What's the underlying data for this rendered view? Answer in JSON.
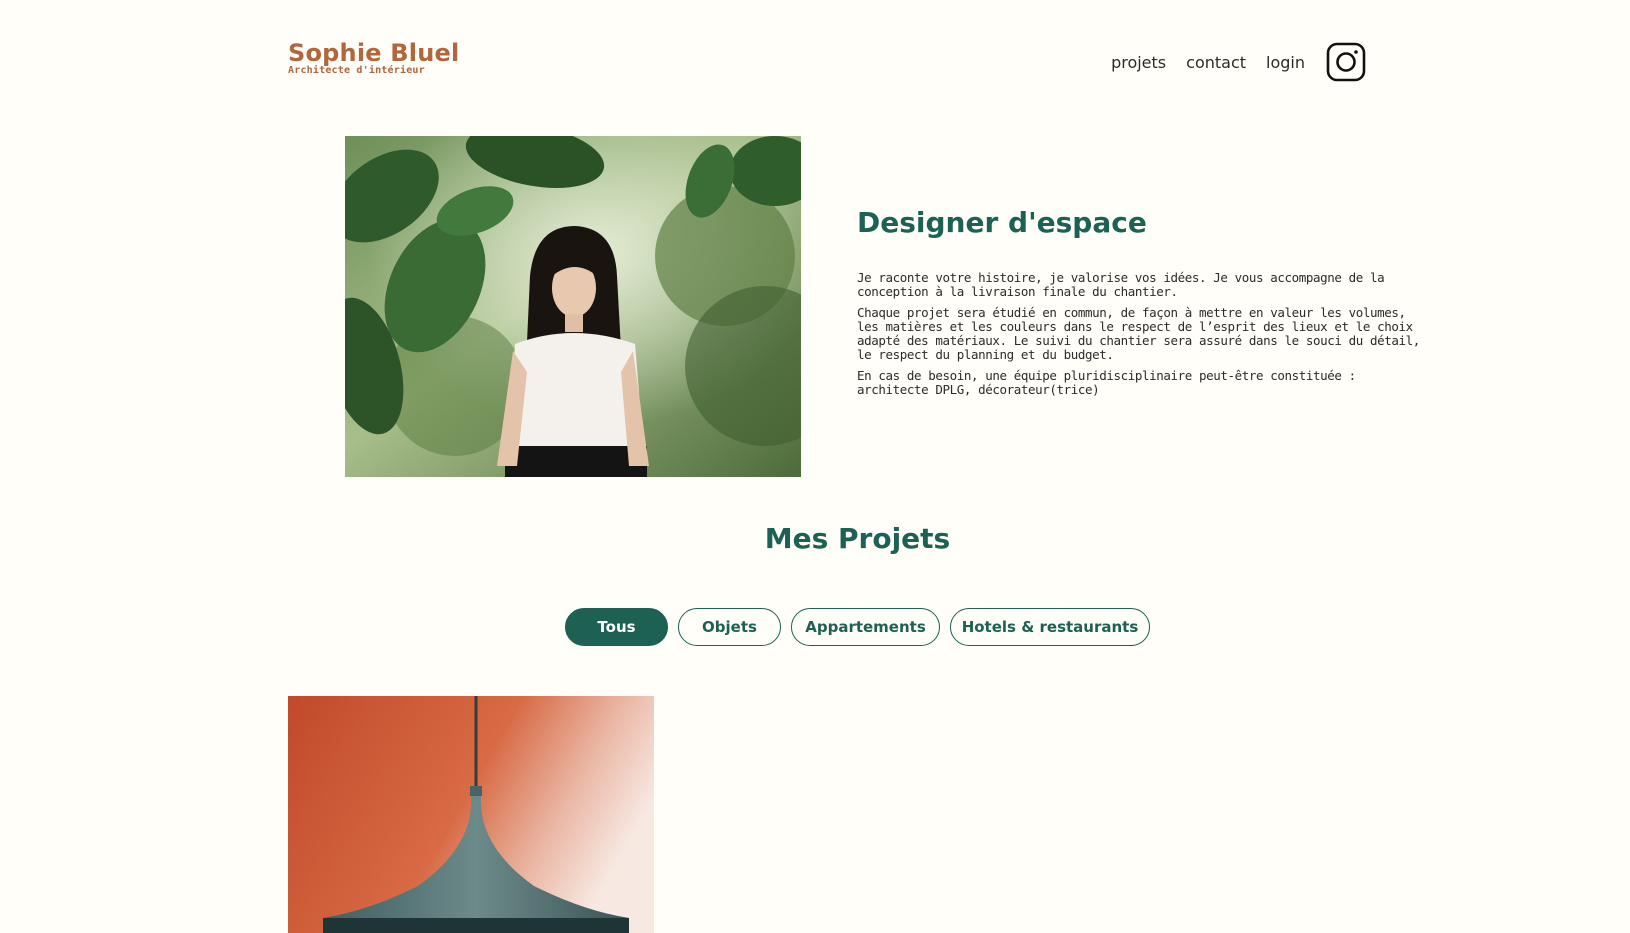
{
  "header": {
    "logo_title": "Sophie Bluel",
    "logo_subtitle": "Architecte d'intérieur",
    "nav": [
      {
        "label": "projets"
      },
      {
        "label": "contact"
      },
      {
        "label": "login"
      }
    ],
    "social_icon": "instagram-icon"
  },
  "intro": {
    "title": "Designer d'espace",
    "paragraphs": [
      "Je raconte votre histoire, je valorise vos idées. Je vous accompagne de la conception à la livraison finale du chantier.",
      "Chaque projet sera étudié en commun, de façon à mettre en valeur les volumes, les matières et les couleurs dans le respect de l’esprit des lieux et le choix adapté des matériaux. Le suivi du chantier sera assuré dans le souci du détail, le respect du planning et du budget.",
      "En cas de besoin, une équipe pluridisciplinaire peut-être constituée : architecte DPLG, décorateur(trice)"
    ]
  },
  "projects": {
    "title": "Mes Projets",
    "filters": [
      {
        "label": "Tous",
        "active": true
      },
      {
        "label": "Objets",
        "active": false
      },
      {
        "label": "Appartements",
        "active": false
      },
      {
        "label": "Hotels & restaurants",
        "active": false
      }
    ]
  },
  "colors": {
    "brand": "#b1663c",
    "accent": "#1d6154",
    "background": "#fffef8"
  }
}
